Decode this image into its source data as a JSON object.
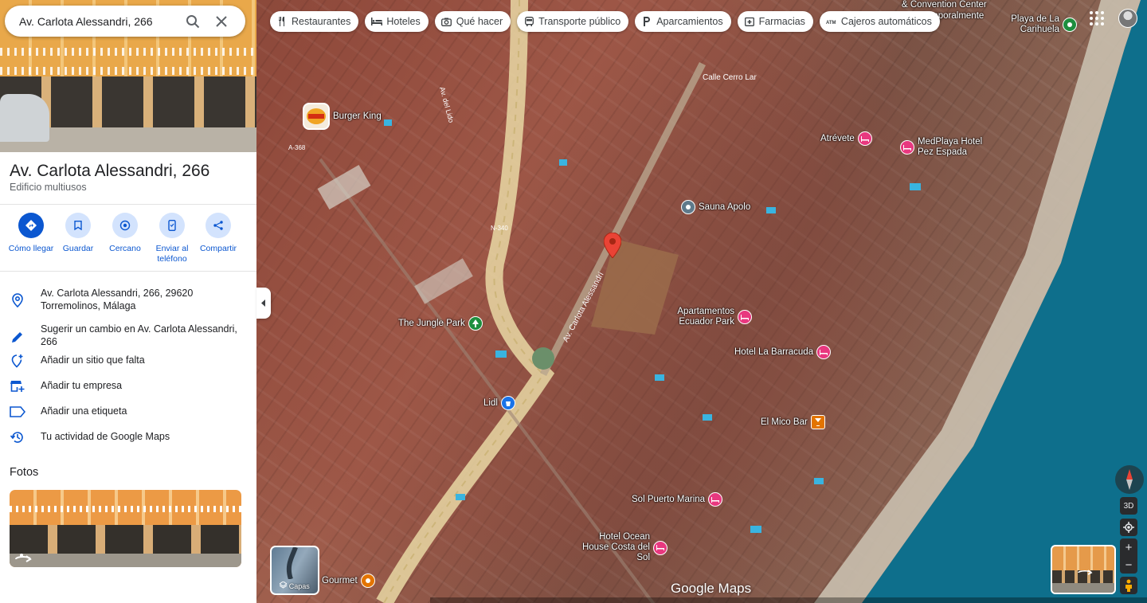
{
  "search": {
    "value": "Av. Carlota Alessandri, 266"
  },
  "place": {
    "title": "Av. Carlota Alessandri, 266",
    "subtitle": "Edificio multiusos"
  },
  "actions": [
    {
      "label": "Cómo llegar",
      "icon": "directions-icon"
    },
    {
      "label": "Guardar",
      "icon": "bookmark-icon"
    },
    {
      "label": "Cercano",
      "icon": "nearby-icon"
    },
    {
      "label": "Enviar al teléfono",
      "icon": "phone-icon"
    },
    {
      "label": "Compartir",
      "icon": "share-icon"
    }
  ],
  "info_rows": [
    {
      "text": "Av. Carlota Alessandri, 266, 29620 Torremolinos, Málaga",
      "icon": "location-pin-icon"
    },
    {
      "text": "Sugerir un cambio en Av. Carlota Alessandri, 266",
      "icon": "edit-pencil-icon"
    },
    {
      "text": "Añadir un sitio que falta",
      "icon": "add-location-icon"
    },
    {
      "text": "Añadir tu empresa",
      "icon": "add-business-icon"
    },
    {
      "text": "Añadir una etiqueta",
      "icon": "label-icon"
    },
    {
      "text": "Tu actividad de Google Maps",
      "icon": "history-icon"
    }
  ],
  "photos": {
    "title": "Fotos"
  },
  "chips": [
    {
      "label": "Restaurantes",
      "icon": "restaurant-icon"
    },
    {
      "label": "Hoteles",
      "icon": "hotel-icon"
    },
    {
      "label": "Qué hacer",
      "icon": "camera-icon"
    },
    {
      "label": "Transporte público",
      "icon": "transit-icon"
    },
    {
      "label": "Aparcamientos",
      "icon": "parking-icon"
    },
    {
      "label": "Farmacias",
      "icon": "pharmacy-icon"
    },
    {
      "label": "Cajeros automáticos",
      "icon": "atm-icon"
    }
  ],
  "map": {
    "pois": [
      {
        "label": "Burger King",
        "kind": "food"
      },
      {
        "label": "Sauna Apolo",
        "kind": "service"
      },
      {
        "label": "Atrévete",
        "kind": "hotel"
      },
      {
        "label": "MedPlaya Hotel Pez Espada",
        "kind": "hotel"
      },
      {
        "label": "Apartamentos Ecuador Park",
        "kind": "hotel"
      },
      {
        "label": "Hotel La Barracuda",
        "kind": "hotel"
      },
      {
        "label": "The Jungle Park",
        "kind": "park"
      },
      {
        "label": "Lidl",
        "kind": "shop"
      },
      {
        "label": "El Mico Bar",
        "kind": "bar"
      },
      {
        "label": "Sol Puerto Marina",
        "kind": "hotel"
      },
      {
        "label": "Hotel Ocean House Costa del Sol",
        "kind": "hotel"
      },
      {
        "label": "Playa de La Carihuela",
        "kind": "beach"
      },
      {
        "label": "& Convention Center",
        "kind": "text"
      },
      {
        "label": "o temporalmente",
        "kind": "text"
      },
      {
        "label": "Gourmet",
        "kind": "food"
      }
    ],
    "roads": [
      "Calle Cerro Lar",
      "A-368",
      "N-340",
      "Av. Carlota Alessandri",
      "Av. del Lido"
    ],
    "layers_label": "Capas",
    "view_3d": "3D",
    "brand": "Google Maps"
  },
  "colors": {
    "accent": "#0b57d0",
    "accent_light": "#d3e3fd",
    "hotel_pin": "#e8387f",
    "park_pin": "#1e8e3e",
    "shop_pin": "#1a73e8",
    "bar_pin": "#e37400",
    "main_pin": "#ea4335"
  }
}
